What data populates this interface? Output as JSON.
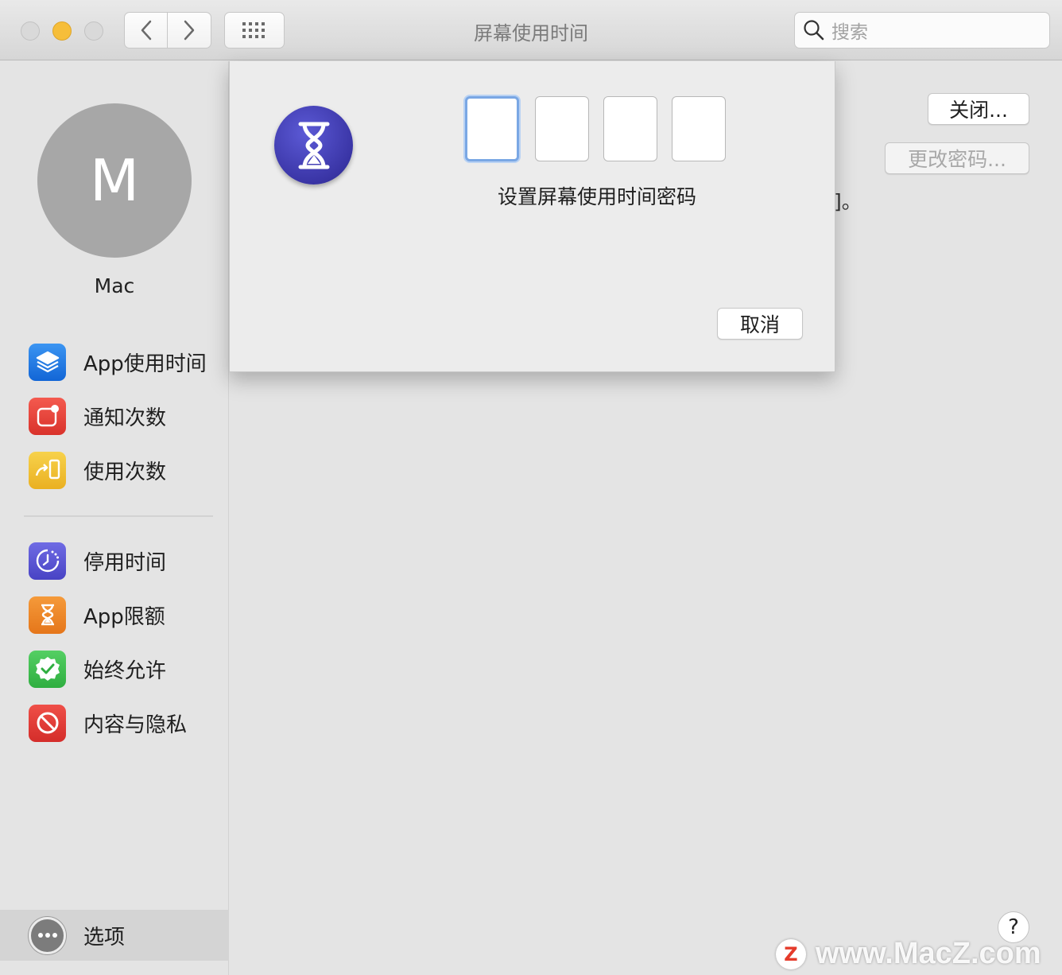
{
  "window": {
    "title": "屏幕使用时间",
    "search_placeholder": "搜索"
  },
  "sidebar": {
    "avatar_initial": "M",
    "user_name": "Mac",
    "items": [
      {
        "label": "App使用时间",
        "icon": "app-usage-icon",
        "color": "#1f7ce8"
      },
      {
        "label": "通知次数",
        "icon": "notifications-icon",
        "color": "#e8433b"
      },
      {
        "label": "使用次数",
        "icon": "pickups-icon",
        "color": "#f2c232"
      },
      {
        "label": "停用时间",
        "icon": "downtime-icon",
        "color": "#5b57d6"
      },
      {
        "label": "App限额",
        "icon": "app-limits-icon",
        "color": "#f08a26"
      },
      {
        "label": "始终允许",
        "icon": "always-allowed-icon",
        "color": "#3fbf4f"
      },
      {
        "label": "内容与隐私",
        "icon": "content-privacy-icon",
        "color": "#e23b3b"
      }
    ],
    "options_label": "选项"
  },
  "main": {
    "close_button": "关闭...",
    "change_passcode_button": "更改密码...",
    "peek_text": "]。"
  },
  "sheet": {
    "prompt": "设置屏幕使用时间密码",
    "cancel_button": "取消",
    "pin_boxes": [
      "",
      "",
      "",
      ""
    ]
  },
  "watermark": {
    "logo": "Z",
    "text": "www.MacZ.com"
  }
}
